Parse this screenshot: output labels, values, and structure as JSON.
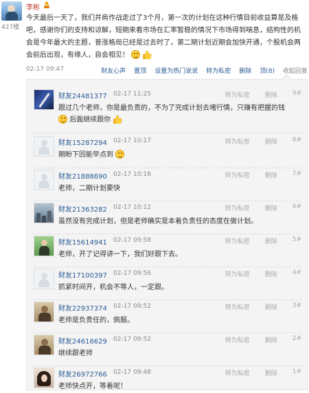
{
  "post": {
    "author": "李彬",
    "floor": "427楼",
    "text": "今天最后一天了，我们并肩作战走过了3个月，第一次的计划在这种行情目前收益算是及格吧，感谢你们的支持和谅解，短期来看市场在汇率暂稳的情况下市场得到喘息，结构性的机会是今年最大的主题，普涨格局已经是过去时了，第二期计划近期会加快开通，个股机会两会前后出现，有缘人，自会相见！",
    "time": "02-17 09:47",
    "actions": [
      "财友心声",
      "置顶",
      "设置为热门说说",
      "转为私密",
      "删除",
      "顶(8)",
      "收起回复"
    ]
  },
  "replies": [
    {
      "name": "财友24481377",
      "time": "02-17 11:25",
      "text": "跟过几个老师，你是最负责的，不为了完成计划去堵行情，只赚有把握的钱",
      "text2": "后面继续跟你",
      "floor": "9#",
      "avatar": "sword"
    },
    {
      "name": "财友15287294",
      "time": "02-17 10:17",
      "text": "期盼下回能早点到",
      "floor": "8#",
      "avatar": "blank"
    },
    {
      "name": "财友21888690",
      "time": "02-17 10:16",
      "text": "老师，二期计划要快",
      "floor": "7#",
      "avatar": "blank"
    },
    {
      "name": "财友21363282",
      "time": "02-17 10:12",
      "text": "虽然没有完成计划，但是老师确实是本着负责任的态度在做计划。",
      "floor": "6#",
      "avatar": "city"
    },
    {
      "name": "财友15614941",
      "time": "02-17 09:58",
      "text": "老师，开了记得讲一下，我们好跟下去。",
      "floor": "5#",
      "avatar": "person"
    },
    {
      "name": "财友17100397",
      "time": "02-17 09:56",
      "text": "抓紧时间开，机会不等人，一定跟。",
      "floor": "4#",
      "avatar": "blank"
    },
    {
      "name": "财友22937374",
      "time": "02-17 09:52",
      "text": "老师是负责任的，佩服。",
      "floor": "3#",
      "avatar": "old"
    },
    {
      "name": "财友24616629",
      "time": "02-17 09:52",
      "text": "继续跟老师",
      "floor": "2#",
      "avatar": "old"
    },
    {
      "name": "财友26972766",
      "time": "02-17 09:48",
      "text": "老师快点开，等着呢！",
      "floor": "1#",
      "avatar": "hair"
    }
  ],
  "reply_actions": {
    "private": "转为私密",
    "delete": "删除"
  },
  "icons": {
    "badge": "crown-badge-icon",
    "emoji": "smile-emoji-icon",
    "thumb": "thumbs-up-icon"
  },
  "colors": {
    "link": "#2b5b96",
    "author": "#c0392b",
    "reply_bg": "#f4f4f4"
  }
}
